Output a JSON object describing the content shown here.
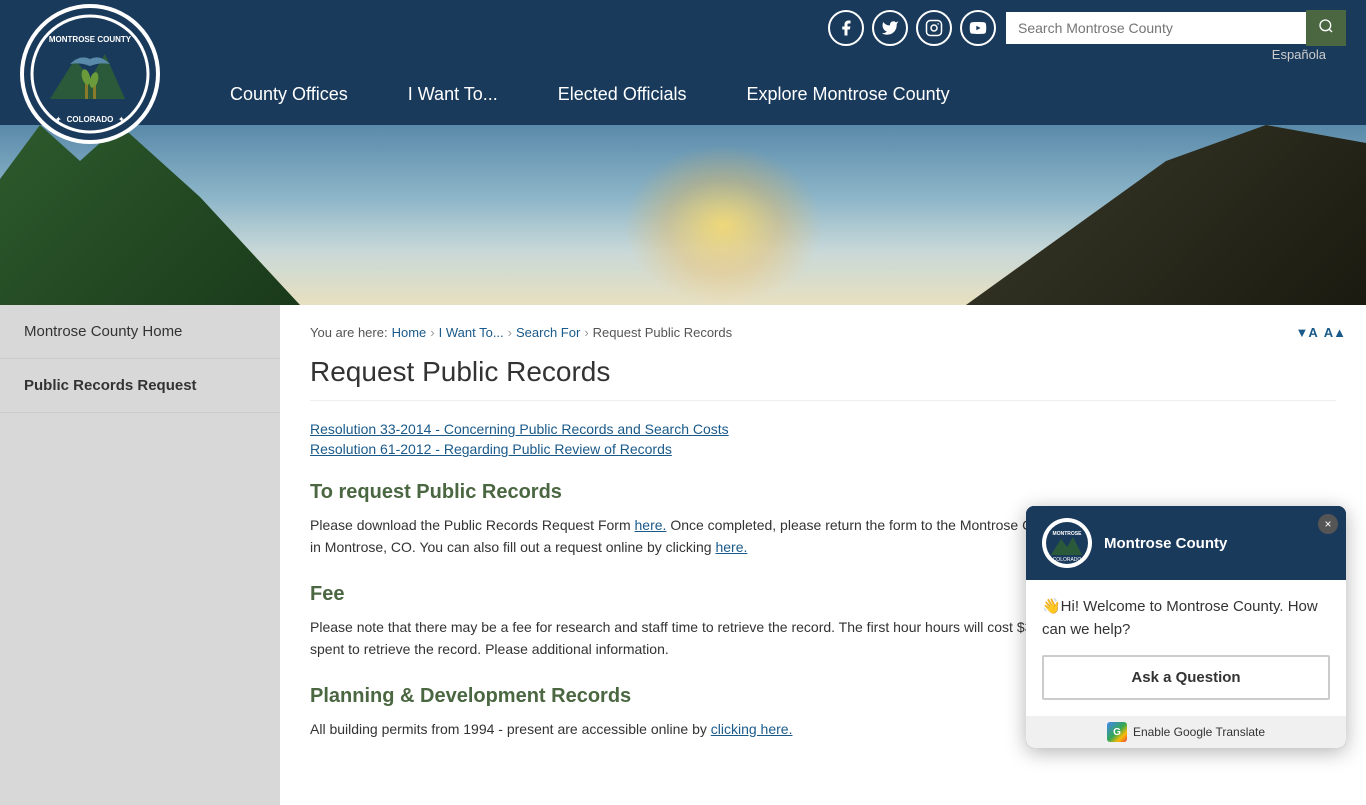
{
  "header": {
    "logo_alt": "Montrose County Colorado",
    "espanola_label": "Española",
    "search_placeholder": "Search Montrose County",
    "search_icon": "search-icon",
    "nav": [
      {
        "label": "County Offices",
        "id": "county-offices"
      },
      {
        "label": "I Want To...",
        "id": "i-want-to"
      },
      {
        "label": "Elected Officials",
        "id": "elected-officials"
      },
      {
        "label": "Explore Montrose County",
        "id": "explore"
      }
    ],
    "social": [
      {
        "icon": "facebook-icon",
        "symbol": "f"
      },
      {
        "icon": "twitter-icon",
        "symbol": "𝕏"
      },
      {
        "icon": "instagram-icon",
        "symbol": "📷"
      },
      {
        "icon": "youtube-icon",
        "symbol": "▶"
      }
    ]
  },
  "breadcrumb": {
    "home": "Home",
    "i_want_to": "I Want To...",
    "search_for": "Search For",
    "current": "Request Public Records"
  },
  "font_controls": {
    "decrease": "▼A",
    "increase": "A▲"
  },
  "page": {
    "title": "Request Public Records",
    "links": [
      {
        "text": "Resolution 33-2014 - Concerning Public Records and Search Costs",
        "href": "#"
      },
      {
        "text": "Resolution 61-2012 - Regarding Public Review of Records",
        "href": "#"
      }
    ],
    "sections": [
      {
        "heading": "To request Public Records",
        "body": "Please download the Public Records Request Form here. Once completed, please return the form to the Montrose County Administration Office at 317 S. 2nd Street in Montrose, CO. You can also fill out a request online by clicking here.",
        "here1_text": "here.",
        "here2_text": "here."
      },
      {
        "heading": "Fee",
        "body": "Please note that there may be a fee for research and staff time to retrieve the record. The first hour hours will cost $30/hour. Fees must be paid in advance of time spent to retrieve the record. Please additional information."
      },
      {
        "heading": "Planning & Development Records",
        "body": "All building permits from 1994 - present are accessible online by clicking here.",
        "here_text": "clicking here."
      }
    ]
  },
  "sidebar": {
    "items": [
      {
        "label": "Montrose County Home",
        "active": false
      },
      {
        "label": "Public Records Request",
        "active": true
      }
    ]
  },
  "chat": {
    "org_name": "Montrose County",
    "greeting": "👋Hi! Welcome to Montrose County. How can we help?",
    "cta_label": "Ask a Question",
    "translate_label": "Enable Google Translate",
    "close_icon": "×"
  }
}
